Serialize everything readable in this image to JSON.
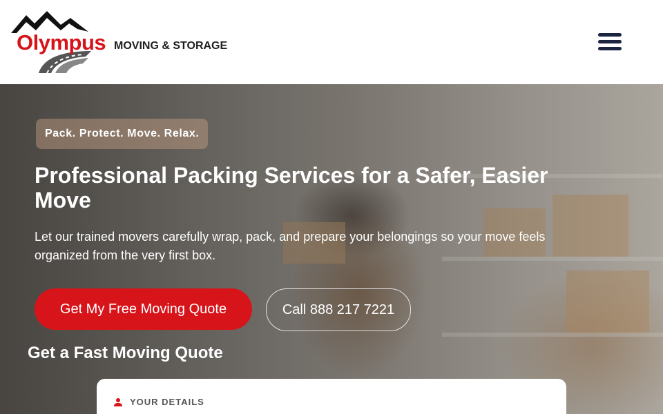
{
  "header": {
    "logo": {
      "brand": "Olympus",
      "tagline": "MOVING & STORAGE"
    },
    "menu_icon": "hamburger-menu-icon"
  },
  "hero": {
    "badge": "Pack. Protect. Move. Relax.",
    "headline": "Professional Packing Services for a Safer, Easier Move",
    "subtext": "Let our trained movers carefully wrap, pack, and prepare your belongings so your move feels organized from the very first box.",
    "primary_button": "Get My Free Moving Quote",
    "secondary_button": "Call 888 217 7221"
  },
  "quote_section": {
    "title": "Get a Fast Moving Quote",
    "card": {
      "icon": "user-icon",
      "label": "YOUR DETAILS"
    }
  },
  "colors": {
    "brand_red": "#d7141a",
    "menu_icon": "#1b2540",
    "tagline": "#1e1e1e"
  }
}
